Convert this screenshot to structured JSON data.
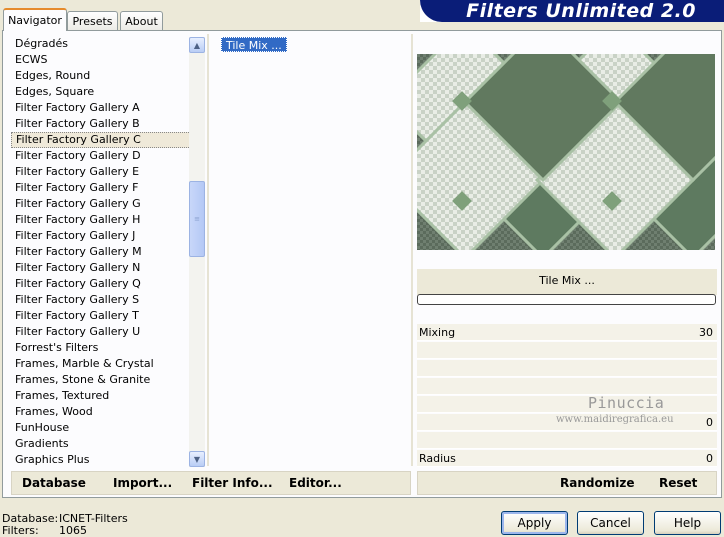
{
  "tabs": [
    "Navigator",
    "Presets",
    "About"
  ],
  "app_title": "Filters Unlimited 2.0",
  "categories": [
    "Dégradés",
    "ECWS",
    "Edges, Round",
    "Edges, Square",
    "Filter Factory Gallery A",
    "Filter Factory Gallery B",
    "Filter Factory Gallery C",
    "Filter Factory Gallery D",
    "Filter Factory Gallery E",
    "Filter Factory Gallery F",
    "Filter Factory Gallery G",
    "Filter Factory Gallery H",
    "Filter Factory Gallery J",
    "Filter Factory Gallery M",
    "Filter Factory Gallery N",
    "Filter Factory Gallery Q",
    "Filter Factory Gallery S",
    "Filter Factory Gallery T",
    "Filter Factory Gallery U",
    "Forrest's Filters",
    "Frames, Marble & Crystal",
    "Frames, Stone & Granite",
    "Frames, Textured",
    "Frames, Wood",
    "FunHouse",
    "Gradients",
    "Graphics Plus"
  ],
  "selected_category": "Filter Factory Gallery C",
  "filters": [
    "Tile Mix ..."
  ],
  "filter_name": "Tile Mix ...",
  "params": {
    "mixing_label": "Mixing",
    "mixing_value": "30",
    "row6_value": "0",
    "radius_label": "Radius",
    "radius_value": "0"
  },
  "watermark": {
    "line1": "Pinuccia",
    "line2": "www.maidiregrafica.eu"
  },
  "left_buttons": {
    "database": "Database",
    "import": "Import...",
    "filter_info": "Filter Info...",
    "editor": "Editor..."
  },
  "right_buttons": {
    "randomize": "Randomize",
    "reset": "Reset"
  },
  "status": {
    "database_label": "Database:",
    "database_value": "ICNET-Filters",
    "filters_label": "Filters:",
    "filters_value": "1065"
  },
  "dialog_buttons": {
    "apply": "Apply",
    "cancel": "Cancel",
    "help": "Help"
  },
  "colors": {
    "title_bg": "#0a1d78",
    "selection": "#316ac5",
    "preview_dark": "#5f7561",
    "preview_light": "#cfd8cc"
  }
}
